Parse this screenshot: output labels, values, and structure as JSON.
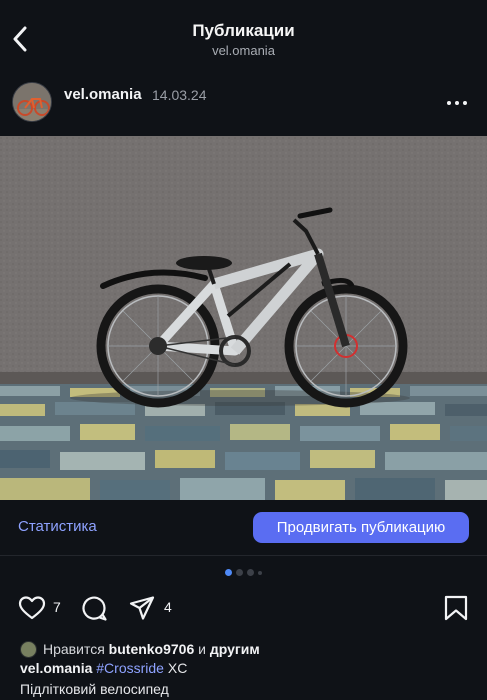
{
  "header": {
    "title": "Публикации",
    "subtitle": "vel.omania",
    "back_icon": "chevron-left-icon"
  },
  "post": {
    "username": "vel.omania",
    "date": "14.03.24",
    "more_icon": "more-horizontal-icon",
    "image_subject": "bicycle"
  },
  "insights": {
    "stats_label": "Статистика",
    "promote_label": "Продвигать публикацию"
  },
  "carousel": {
    "active_index": 0,
    "dot_count": 4
  },
  "actions": {
    "like_count": "7",
    "share_count": "4",
    "icons": [
      "heart-icon",
      "comment-icon",
      "send-icon",
      "bookmark-icon"
    ]
  },
  "likes": {
    "prefix": "Нравится",
    "user": "butenko9706",
    "middle": "и",
    "others": "другим"
  },
  "caption": {
    "username": "vel.omania",
    "hashtag": "#Crossride",
    "rest": "XC",
    "line2": "Підлітковий велосипед"
  },
  "colors": {
    "background": "#0f1217",
    "accent": "#5a6df2",
    "link": "#8ea2ff"
  }
}
